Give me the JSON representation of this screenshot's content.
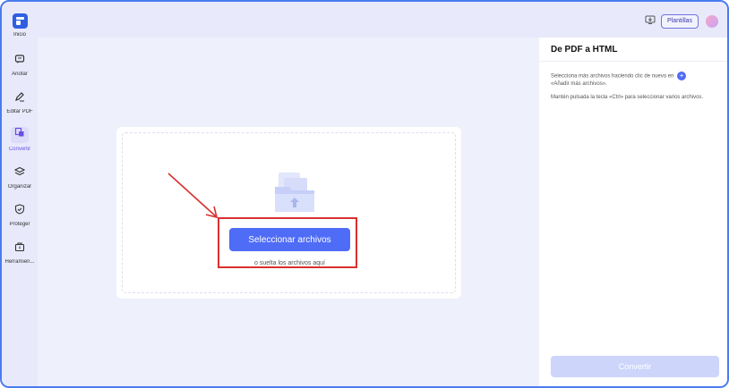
{
  "sidebar": {
    "items": [
      {
        "label": "Inicio",
        "icon": "home-icon"
      },
      {
        "label": "Anotar",
        "icon": "annotate-icon"
      },
      {
        "label": "Editar PDF",
        "icon": "edit-icon"
      },
      {
        "label": "Convertir",
        "icon": "convert-icon"
      },
      {
        "label": "Organizar",
        "icon": "organize-icon"
      },
      {
        "label": "Proteger",
        "icon": "shield-icon"
      },
      {
        "label": "Herramien...",
        "icon": "tools-icon"
      }
    ]
  },
  "topbar": {
    "templates_label": "Plantillas"
  },
  "main": {
    "select_button_label": "Seleccionar archivos",
    "drop_hint": "o suelta los archivos aquí"
  },
  "panel": {
    "title": "De PDF a HTML",
    "hint_1": "Selecciona más archivos haciendo clic de nuevo en",
    "hint_1b": "«Añadir más archivos».",
    "hint_2": "Mantén pulsada la tecla «Ctrl» para seleccionar varios archivos.",
    "convert_label": "Convertir"
  },
  "colors": {
    "accent": "#4f6cf7",
    "active_nav": "#6a4fe0",
    "highlight": "#d93030",
    "convert_disabled": "#cdd5fb"
  }
}
